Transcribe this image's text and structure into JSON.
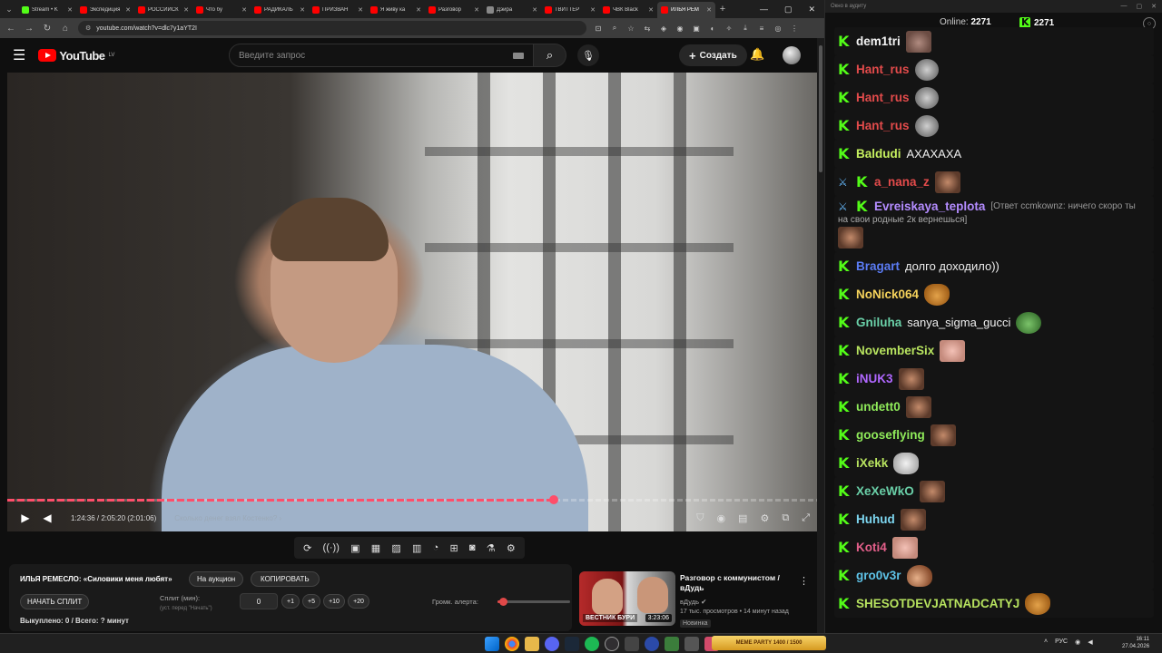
{
  "browser": {
    "tabs": [
      {
        "label": "Stream • K",
        "color": "#53fc18"
      },
      {
        "label": "Экспедиция",
        "color": "#ff0000"
      },
      {
        "label": "РОССИЙСК",
        "color": "#ff0000"
      },
      {
        "label": "Что бу",
        "color": "#ff0000"
      },
      {
        "label": "РАДИКАЛЬ",
        "color": "#ff0000"
      },
      {
        "label": "ПРИЗВАН",
        "color": "#ff0000"
      },
      {
        "label": "Я живу ка",
        "color": "#ff0000"
      },
      {
        "label": "Разговор",
        "color": "#ff0000"
      },
      {
        "label": "Дэйра",
        "color": "#888888"
      },
      {
        "label": "ТВИТТЕР",
        "color": "#ff0000"
      },
      {
        "label": "ЧВК Black",
        "color": "#ff0000"
      },
      {
        "label": "ИЛЬЯ РЕМ",
        "color": "#ff0000"
      }
    ],
    "url": "youtube.com/watch?v=dlc7y1aYT2I"
  },
  "youtube": {
    "logo_text": "YouTube",
    "region": "LV",
    "search_placeholder": "Введите запрос",
    "create_label": "Создать",
    "player": {
      "time": "1:24:36 / 2:05:20 (2:01:06)",
      "chapter": "Сколько денег взял Костенко?",
      "progress": 0.675
    },
    "clipper": {
      "title": "ИЛЬЯ РЕМЕСЛО: «Силовики меня любят»",
      "auction": "На аукцион",
      "copy": "КОПИРОВАТЬ",
      "start_split": "НАЧАТЬ СПЛИТ",
      "split_label": "Сплит (мин):",
      "split_hint": "(уст. перед \"Начать\")",
      "split_value": "0",
      "plus": [
        "+1",
        "+5",
        "+10",
        "+20"
      ],
      "alert_label": "Громк. алерта:",
      "alert_volume": 0.08,
      "stats": "Выкуплено: 0 / Всего: ? минут"
    },
    "recommendation": {
      "title": "Разговор с коммунистом / вДудь",
      "channel": "вДудь",
      "meta": "17 тыс. просмотров • 14 минут назад",
      "badge": "Новинка",
      "thumb_caption": "ВЕСТНИК БУРИ",
      "duration": "3:23:06"
    }
  },
  "chat": {
    "window_title": "Окно в аудиту",
    "online_label": "Online:",
    "online_count": "2271",
    "k_count": "2271",
    "messages": [
      {
        "name": "dem1tri",
        "color": "#f2f2f2",
        "text": "",
        "emote": "pig"
      },
      {
        "name": "Hant_rus",
        "color": "#e34b4b",
        "text": "",
        "emote": "rat"
      },
      {
        "name": "Hant_rus",
        "color": "#e34b4b",
        "text": "",
        "emote": "rat"
      },
      {
        "name": "Hant_rus",
        "color": "#e34b4b",
        "text": "",
        "emote": "rat"
      },
      {
        "name": "Baldudi",
        "color": "#c6f05f",
        "text": "АХАХАХА",
        "emote": ""
      },
      {
        "name": "a_nana_z",
        "color": "#e34b4b",
        "text": "",
        "emote": "man",
        "badge": true
      },
      {
        "name": "Evreiskaya_teplota",
        "color": "#b48cff",
        "text": "",
        "emote": "man",
        "badge": true,
        "reply": "[Ответ ccmkownz: ничего скоро ты",
        "cont": "на свои родные 2к вернешься]"
      },
      {
        "name": "Bragart",
        "color": "#5b7cf5",
        "text": "долго доходило))",
        "emote": ""
      },
      {
        "name": "NoNick064",
        "color": "#f5d25b",
        "text": "",
        "emote": "fox"
      },
      {
        "name": "Gniluha",
        "color": "#6ad0a8",
        "text": "sanya_sigma_gucci",
        "emote": "pepe"
      },
      {
        "name": "NovemberSix",
        "color": "#b7e35f",
        "text": "",
        "emote": "pinkm"
      },
      {
        "name": "iNUK3",
        "color": "#b067ff",
        "text": "",
        "emote": "man"
      },
      {
        "name": "undett0",
        "color": "#8fea5a",
        "text": "",
        "emote": "man"
      },
      {
        "name": "gooseflying",
        "color": "#8fea5a",
        "text": "",
        "emote": "man"
      },
      {
        "name": "iXekk",
        "color": "#b7e35f",
        "text": "",
        "emote": "cat"
      },
      {
        "name": "XeXeWkO",
        "color": "#6ad0a8",
        "text": "",
        "emote": "man"
      },
      {
        "name": "Huhud",
        "color": "#7dd6f0",
        "text": "",
        "emote": "man"
      },
      {
        "name": "Koti4",
        "color": "#e35f8a",
        "text": "",
        "emote": "pinkm"
      },
      {
        "name": "gro0v3r",
        "color": "#5ec3e8",
        "text": "",
        "emote": "hand"
      },
      {
        "name": "SHESOTDEVJATNADCATYJ",
        "color": "#b7e35f",
        "text": "",
        "emote": "fox"
      }
    ]
  },
  "taskbar": {
    "meme_label": "MEME PARTY 1400 / 1500",
    "lang": "РУС",
    "time": "16:11",
    "date": "27.04.2026"
  }
}
